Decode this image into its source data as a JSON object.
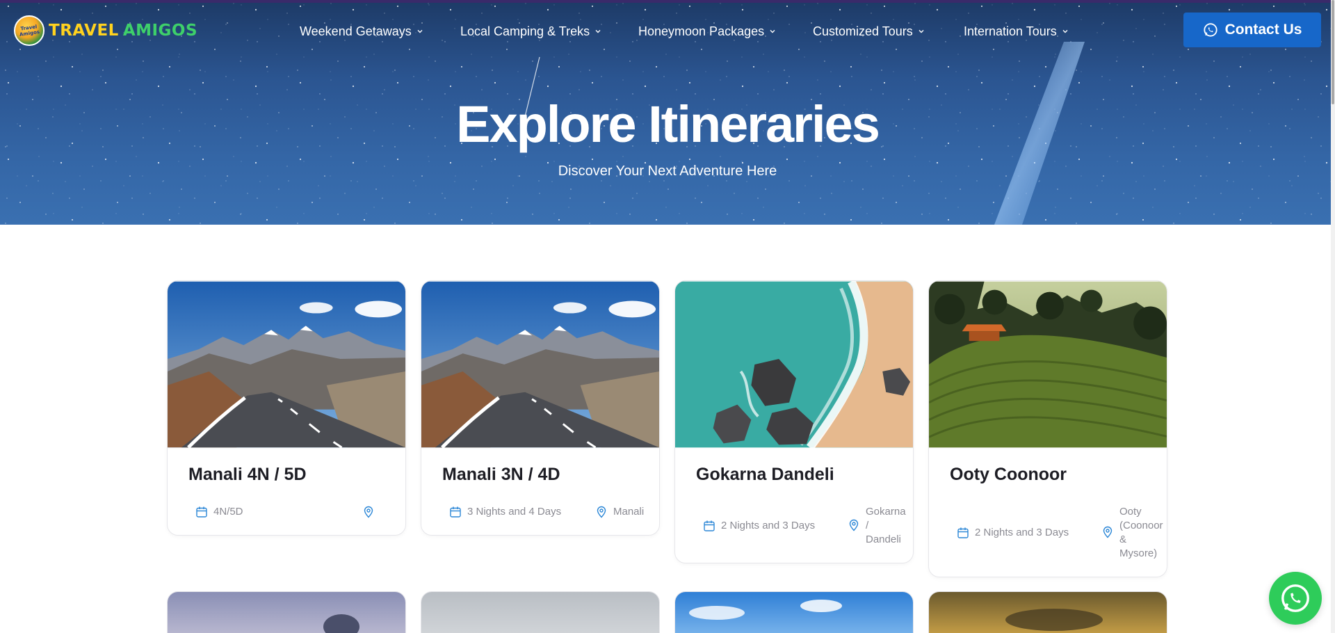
{
  "brand": {
    "logo_badge": "Travel Amigos",
    "word1": "TRAVEL",
    "word2": "AMIGOS"
  },
  "nav": {
    "items": [
      {
        "label": "Weekend Getaways"
      },
      {
        "label": "Local Camping & Treks"
      },
      {
        "label": "Honeymoon Packages"
      },
      {
        "label": "Customized Tours"
      },
      {
        "label": "Internation Tours"
      }
    ],
    "contact_label": "Contact Us"
  },
  "hero": {
    "title": "Explore Itineraries",
    "subtitle": "Discover Your Next Adventure Here"
  },
  "cards": [
    {
      "title": "Manali 4N / 5D",
      "duration": "4N/5D",
      "location": "",
      "image": "mountain-road"
    },
    {
      "title": "Manali 3N / 4D",
      "duration": "3 Nights and 4 Days",
      "location": "Manali",
      "image": "mountain-road"
    },
    {
      "title": "Gokarna Dandeli",
      "duration": "2 Nights and 3 Days",
      "location": "Gokarna / Dandeli",
      "image": "beach-aerial"
    },
    {
      "title": "Ooty Coonoor",
      "duration": "2 Nights and 3 Days",
      "location": "Ooty (Coonoor & Mysore)",
      "image": "tea-plantation"
    }
  ],
  "colors": {
    "accent": "#1767c9",
    "whatsapp": "#2ecc5a",
    "meta_icon": "#2a86d6",
    "logo_yellow": "#ffd21f",
    "logo_green": "#3ed06a"
  },
  "icons": {
    "contact": "whatsapp-icon",
    "duration": "calendar-icon",
    "location": "map-pin-icon",
    "menu": "chevron-down-icon",
    "float": "whatsapp-icon"
  }
}
